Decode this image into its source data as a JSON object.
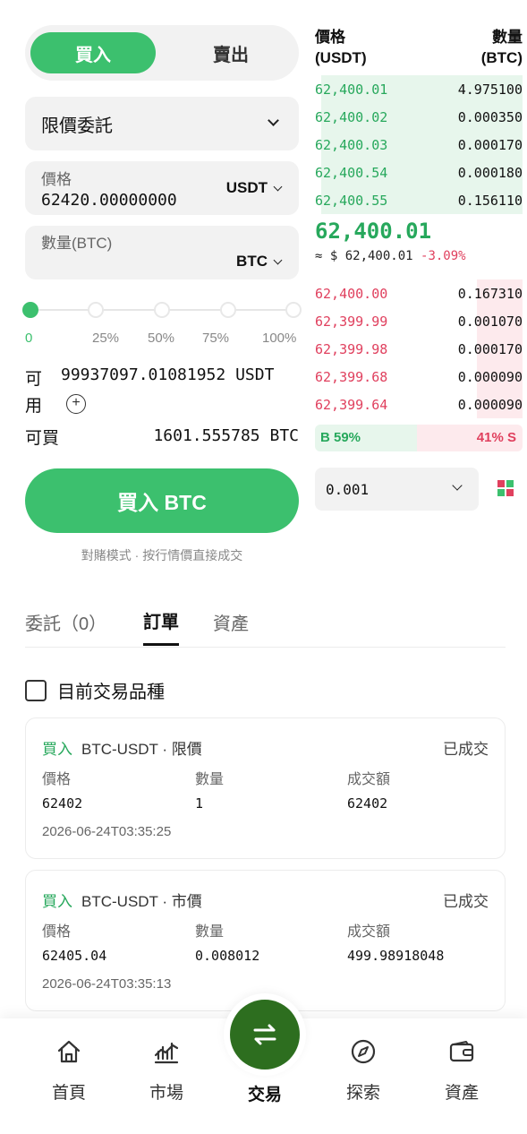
{
  "trade": {
    "buy_label": "買入",
    "sell_label": "賣出",
    "order_type": "限價委託",
    "price_label": "價格",
    "price_value": "62420.00000000",
    "price_unit": "USDT",
    "qty_label": "數量(BTC)",
    "qty_unit": "BTC",
    "slider_ticks": [
      "0",
      "25%",
      "50%",
      "75%",
      "100%"
    ],
    "slider_percent": 0,
    "available_label_1": "可",
    "available_label_2": "用",
    "available_value": "99937097.01081952 USDT",
    "can_buy_label": "可買",
    "can_buy_value": "1601.555785 BTC",
    "submit_label": "買入 BTC",
    "hint": "對賭模式 · 按行情價直接成交"
  },
  "book": {
    "header_price": "價格",
    "header_price_unit": "(USDT)",
    "header_qty": "數量",
    "header_qty_unit": "(BTC)",
    "asks": [
      {
        "price": "62,400.01",
        "qty": "4.975100",
        "depth": 0.97
      },
      {
        "price": "62,400.02",
        "qty": "0.000350",
        "depth": 0.97
      },
      {
        "price": "62,400.03",
        "qty": "0.000170",
        "depth": 0.97
      },
      {
        "price": "62,400.54",
        "qty": "0.000180",
        "depth": 0.97
      },
      {
        "price": "62,400.55",
        "qty": "0.156110",
        "depth": 0.97
      }
    ],
    "last_price": "62,400.01",
    "approx": "≈ $ 62,400.01",
    "change": "-3.09%",
    "bids": [
      {
        "price": "62,400.00",
        "qty": "0.167310",
        "depth": 0.22
      },
      {
        "price": "62,399.99",
        "qty": "0.001070",
        "depth": 0.22
      },
      {
        "price": "62,399.98",
        "qty": "0.000170",
        "depth": 0.22
      },
      {
        "price": "62,399.68",
        "qty": "0.000090",
        "depth": 0.22
      },
      {
        "price": "62,399.64",
        "qty": "0.000090",
        "depth": 0.22
      }
    ],
    "buy_ratio": "B 59%",
    "sell_ratio": "41% S",
    "precision": "0.001"
  },
  "tabs": {
    "pending": "委託（0）",
    "orders": "訂單",
    "assets": "資產"
  },
  "filter_label": "目前交易品種",
  "orders": [
    {
      "side": "買入",
      "title": "BTC-USDT · 限價",
      "status": "已成交",
      "price_label": "價格",
      "price": "62402",
      "qty_label": "數量",
      "qty": "1",
      "amount_label": "成交額",
      "amount": "62402",
      "time": "2026-06-24T03:35:25"
    },
    {
      "side": "買入",
      "title": "BTC-USDT · 市價",
      "status": "已成交",
      "price_label": "價格",
      "price": "62405.04",
      "qty_label": "數量",
      "qty": "0.008012",
      "amount_label": "成交額",
      "amount": "499.98918048",
      "time": "2026-06-24T03:35:13"
    }
  ],
  "nav": {
    "home": "首頁",
    "market": "市場",
    "trade": "交易",
    "explore": "探索",
    "assets": "資產"
  },
  "colors": {
    "accent_green": "#3cc06e",
    "ask_green": "#27a85c",
    "bid_red": "#e0405e",
    "nav_center": "#2d6e1f"
  }
}
